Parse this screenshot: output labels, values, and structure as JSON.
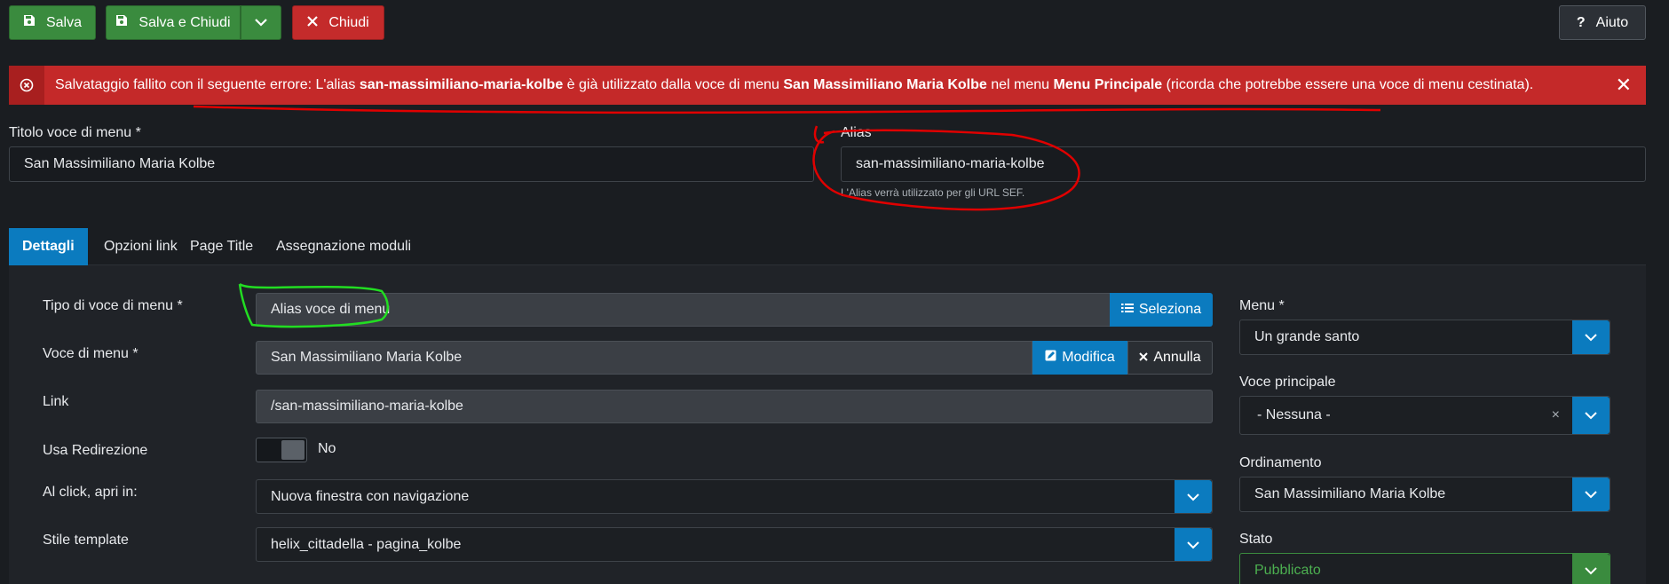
{
  "toolbar": {
    "save_label": "Salva",
    "save_close_label": "Salva e Chiudi",
    "close_label": "Chiudi",
    "help_label": "Aiuto"
  },
  "alert": {
    "text_1": "Salvataggio fallito con il seguente errore: L'alias ",
    "alias_bold": "san-massimiliano-maria-kolbe",
    "text_2": " è già utilizzato dalla voce di menu ",
    "item_bold": "San Massimiliano Maria Kolbe",
    "text_3": " nel menu ",
    "menu_bold": "Menu Principale",
    "text_4": " (ricorda che potrebbe essere una voce di menu cestinata).",
    "close_symbol": "✕"
  },
  "title_field": {
    "label": "Titolo voce di menu *",
    "value": "San Massimiliano Maria Kolbe"
  },
  "alias_field": {
    "label": "Alias",
    "value": "san-massimiliano-maria-kolbe",
    "hint": "L'Alias verrà utilizzato per gli URL SEF."
  },
  "tabs": [
    {
      "label": "Dettagli",
      "active": true
    },
    {
      "label": "Opzioni link",
      "active": false
    },
    {
      "label": "Page Title",
      "active": false
    },
    {
      "label": "Assegnazione moduli",
      "active": false
    }
  ],
  "details": {
    "menu_type": {
      "label": "Tipo di voce di menu *",
      "value": "Alias voce di menu",
      "button": "Seleziona"
    },
    "menu_item": {
      "label": "Voce di menu *",
      "value": "San Massimiliano Maria Kolbe",
      "edit_button": "Modifica",
      "cancel_button": "Annulla"
    },
    "link": {
      "label": "Link",
      "value": "/san-massimiliano-maria-kolbe"
    },
    "redirect": {
      "label": "Usa Redirezione",
      "value": "No"
    },
    "open_in": {
      "label": "Al click, apri in:",
      "value": "Nuova finestra con navigazione"
    },
    "template_style": {
      "label": "Stile template",
      "value": "helix_cittadella - pagina_kolbe"
    }
  },
  "sidebar": {
    "menu": {
      "label": "Menu *",
      "value": "Un grande santo"
    },
    "parent": {
      "label": "Voce principale",
      "value": "- Nessuna -",
      "clear": "×"
    },
    "ordering": {
      "label": "Ordinamento",
      "value": "San Massimiliano Maria Kolbe"
    },
    "status": {
      "label": "Stato",
      "value": "Pubblicato"
    }
  },
  "colors": {
    "green": "#3a8b3e",
    "red": "#c42b2b",
    "blue": "#0b7bbf",
    "annotation_red": "#e00000",
    "annotation_green": "#22dd22"
  }
}
